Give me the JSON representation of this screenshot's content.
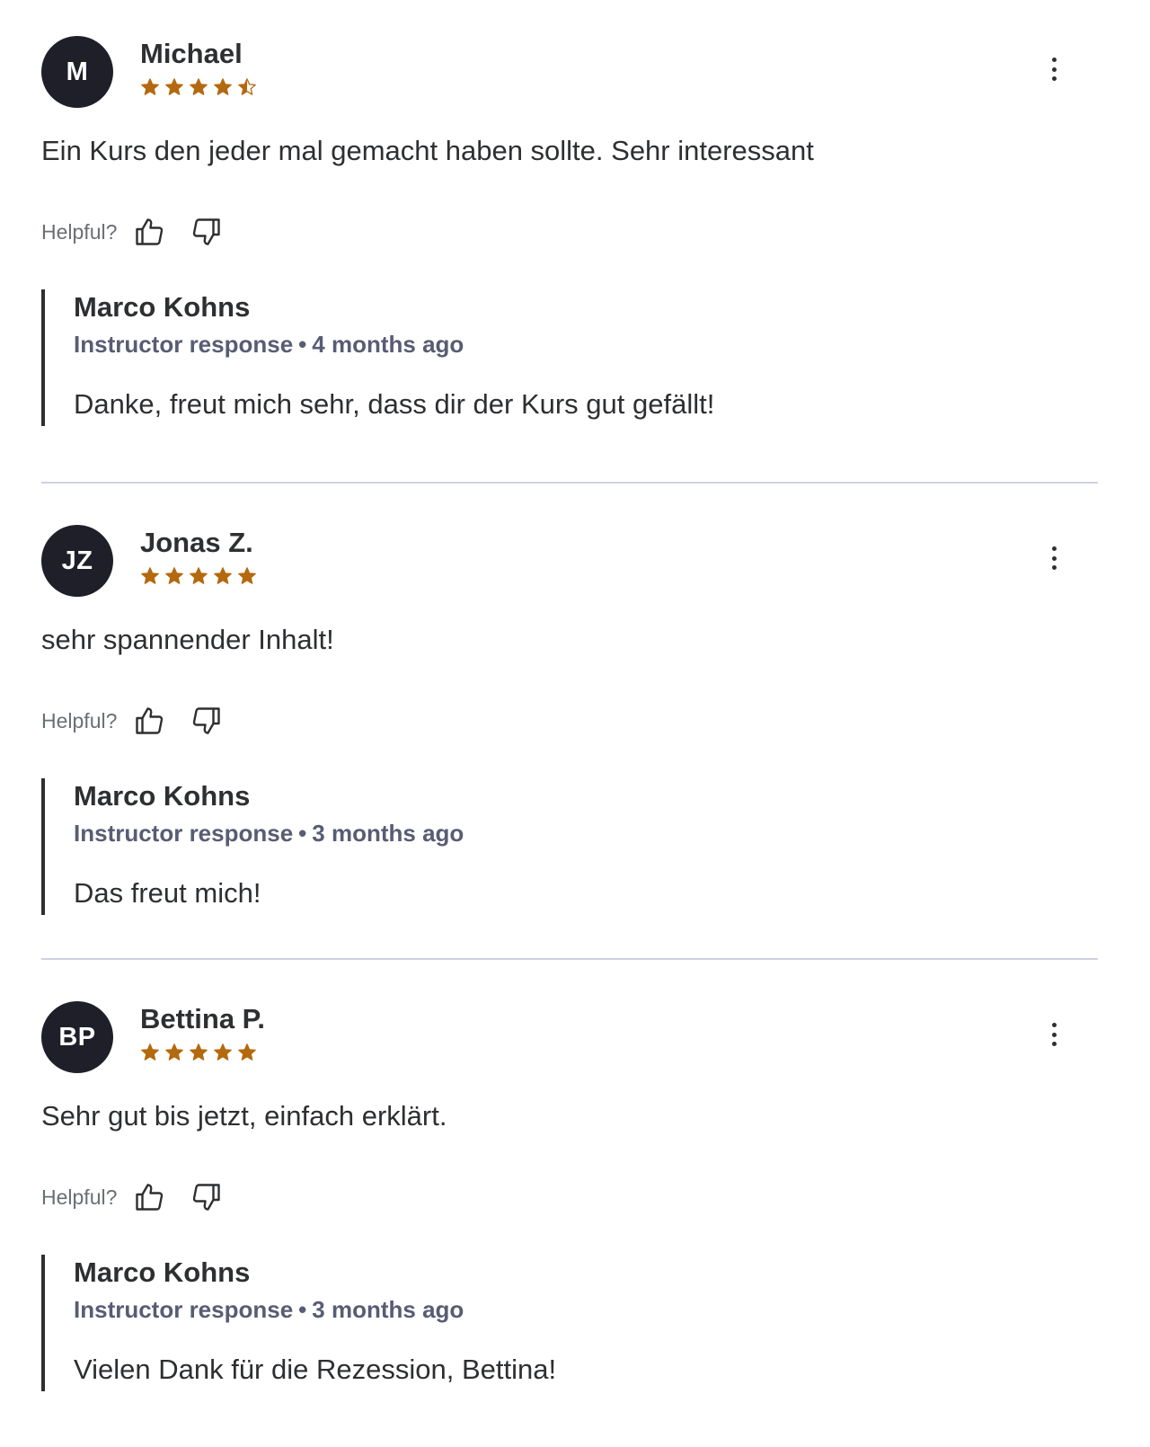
{
  "colors": {
    "star": "#b4690e",
    "avatar_bg": "#1f1f2a",
    "text": "#2d2f31",
    "muted": "#595c73",
    "divider": "#d1d2e0"
  },
  "helpful_label": "Helpful?",
  "icons": {
    "rating": "star-icon",
    "more": "more-vertical-icon",
    "up": "thumbs-up-icon",
    "down": "thumbs-down-icon"
  },
  "reviews": [
    {
      "initials": "M",
      "name": "Michael",
      "rating": 4.5,
      "comment": "Ein Kurs den jeder mal gemacht haben sollte. Sehr interessant",
      "response": {
        "name": "Marco Kohns",
        "label": "Instructor response",
        "separator": "•",
        "time": "4 months ago",
        "text": "Danke, freut mich sehr, dass dir der Kurs gut gefällt!"
      }
    },
    {
      "initials": "JZ",
      "name": "Jonas Z.",
      "rating": 5,
      "comment": "sehr spannender Inhalt!",
      "response": {
        "name": "Marco Kohns",
        "label": "Instructor response",
        "separator": "•",
        "time": "3 months ago",
        "text": "Das freut mich!"
      }
    },
    {
      "initials": "BP",
      "name": "Bettina P.",
      "rating": 5,
      "comment": "Sehr gut bis jetzt, einfach erklärt.",
      "response": {
        "name": "Marco Kohns",
        "label": "Instructor response",
        "separator": "•",
        "time": "3 months ago",
        "text": "Vielen Dank für die Rezession, Bettina!"
      }
    }
  ]
}
